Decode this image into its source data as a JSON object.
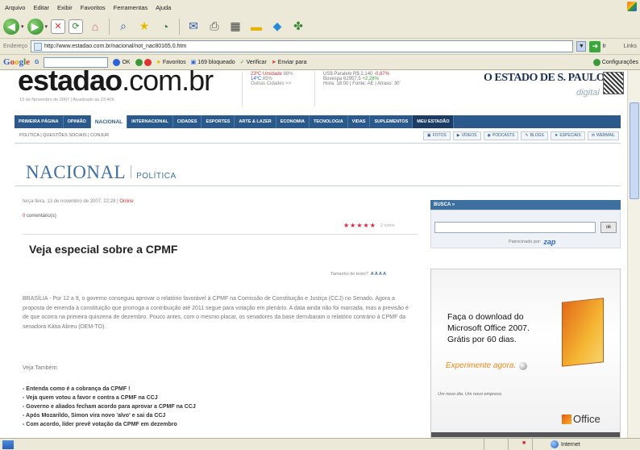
{
  "menu": [
    "Arquivo",
    "Editar",
    "Exibir",
    "Favoritos",
    "Ferramentas",
    "Ajuda"
  ],
  "address": {
    "label": "Endereço",
    "url": "http://www.estadao.com.br/nacional/not_nac80165,0.htm",
    "go": "Ir",
    "links": "Links"
  },
  "googlebar": {
    "logo": "Google",
    "go": "G",
    "ok": "OK",
    "favoritos": "Favoritos",
    "bloqueado": "169 bloqueado",
    "verificar": "Verificar",
    "enviar": "Enviar para",
    "config": "Configurações"
  },
  "site": {
    "logo_main": "estadao",
    "logo_tld": ".com.br",
    "logo_sub": "13 de Novembro de 2007 | Atualizado às 22:40h",
    "weather": {
      "vertical": "TEMPO",
      "t1": "23ºC  Umidade",
      "t1v": "88%",
      "t2": "14ºC",
      "t2v": "85%",
      "other": "Outras Cidades >>"
    },
    "finance": {
      "vertical": "MERCADO",
      "usd": "US$ Paralelo",
      "usd_v": "R$ 2,140",
      "usd_c": "-0,87%",
      "bov": "Bovespa",
      "bov_v": "62957,5",
      "bov_c": "+2,28%",
      "time": "Hora: 18:00 | Fonte: AE | Atraso: 30'"
    },
    "oesp": "O ESTADO DE S. PAULO",
    "digital": "digital"
  },
  "nav": [
    "PRIMEIRA PÁGINA",
    "OPINIÃO",
    "NACIONAL",
    "INTERNACIONAL",
    "CIDADES",
    "ESPORTES",
    "ARTE & LAZER",
    "ECONOMIA",
    "TECNOLOGIA",
    "VIDAS",
    "SUPLEMENTOS",
    "MEU ESTADÃO"
  ],
  "subnav": {
    "left": "POLÍTICA | QUESTÕES SOCIAIS | CONJUR",
    "chips": [
      "FOTOS",
      "VÍDEOS",
      "PODCASTS",
      "BLOGS",
      "ESPECIAIS",
      "WEBMAIL"
    ]
  },
  "section": {
    "title": "NACIONAL",
    "sub": "POLÍTICA"
  },
  "article": {
    "date": "terça-feira, 13 de novembro de 2007, 22:28 | ",
    "online": "Online",
    "comments_n": "0",
    "comments_label": " comentário(s)",
    "stars": "★★★★★",
    "votes": "2 votos",
    "headline": "Veja especial sobre a CPMF",
    "fontsize_label": "Tamanho do texto?",
    "fontsize_a": "A A A A",
    "body": "BRASÍLIA - Por 12 a 9, o governo conseguiu aprovar o relatório favorável à CPMF na Comissão de Constituição e Justiça (CCJ) no Senado. Agora a proposta de emenda à constituição que prorroga a contribuição até 2011 segue para votação em plenário. A data ainda não foi marcada, mas a previsão é de que ocorra na primeira quinzena de dezembro.  Pouco antes, com o mesmo placar, os senadores da base derrubaram o relatório contrário à CPMF da senadora Kátia Abreu (DEM-TO).",
    "veja": "Veja Também:",
    "list": [
      "- Entenda como é a cobrança da CPMF !",
      "- Veja quem votou a favor e contra a CPMF na CCJ",
      "- Governo e aliados fecham acordo para aprovar a CPMF na CCJ",
      "- Após Mozarildo, Simon vira novo 'alvo' e sai da CCJ",
      "- Com acordo, líder prevê votação da CPMF em dezembro"
    ]
  },
  "sidebar": {
    "busca": "BUSCA »",
    "ok": "ok",
    "patro": "Patrocinado por:",
    "zap": "zap"
  },
  "ad": {
    "line1": "Faça o download do",
    "line2": "Microsoft Office 2007.",
    "line3": "Grátis por 60 dias.",
    "cta": "Experimente agora.",
    "bar": "Um novo dia. Um novo empreso.",
    "logo": "Office"
  },
  "status": {
    "zone": "Internet"
  }
}
